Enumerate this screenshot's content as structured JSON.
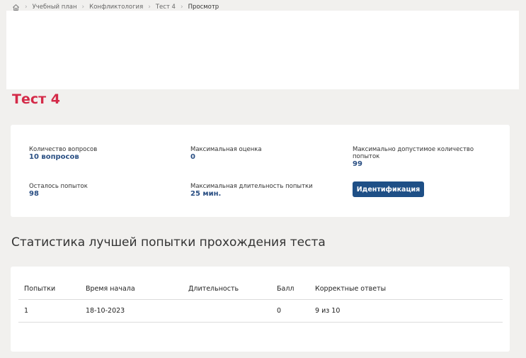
{
  "breadcrumb": {
    "home_icon": "home-icon",
    "items": [
      "Учебный план",
      "Конфликтология",
      "Тест 4",
      "Просмотр"
    ]
  },
  "page_title": "Тест 4",
  "info": {
    "questions_label": "Количество вопросов",
    "questions_value": "10 вопросов",
    "max_grade_label": "Максимальная оценка",
    "max_grade_value": "0",
    "max_attempts_label": "Максимально допустимое количество попыток",
    "max_attempts_value": "99",
    "remaining_label": "Осталось попыток",
    "remaining_value": "98",
    "max_duration_label": "Максимальная длительность попытки",
    "max_duration_value": "25 мин.",
    "ident_button": "Идентификация"
  },
  "stats": {
    "title": "Статистика лучшей попытки прохождения теста",
    "columns": [
      "Попытки",
      "Время начала",
      "Длительность",
      "Балл",
      "Корректные ответы"
    ],
    "rows": [
      [
        "1",
        "18-10-2023",
        "",
        "0",
        "9 из 10"
      ]
    ]
  },
  "colors": {
    "accent": "#d42a48",
    "primary": "#1e4f86",
    "value_text": "#2a4f83"
  }
}
